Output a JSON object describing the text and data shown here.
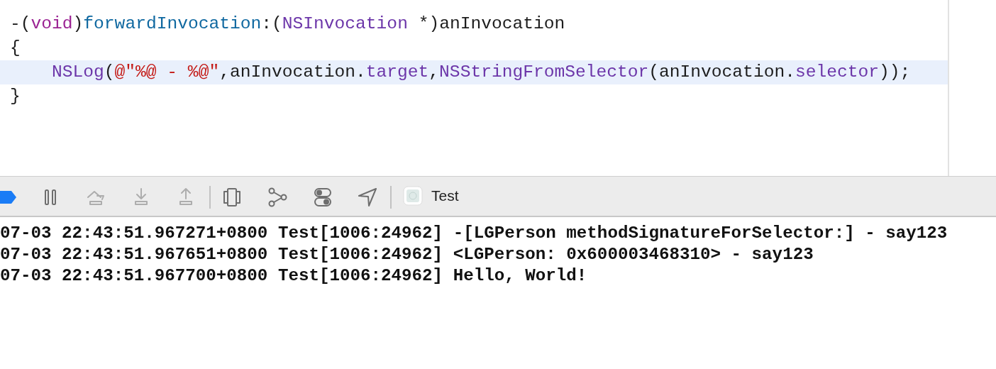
{
  "editor": {
    "lines": [
      {
        "highlighted": false,
        "tokens": [
          {
            "kind": "plain",
            "text": "-("
          },
          {
            "kind": "keyword",
            "text": "void"
          },
          {
            "kind": "plain",
            "text": ")"
          },
          {
            "kind": "declaration",
            "text": "forwardInvocation"
          },
          {
            "kind": "plain",
            "text": ":("
          },
          {
            "kind": "type",
            "text": "NSInvocation"
          },
          {
            "kind": "plain",
            "text": " *)anInvocation"
          }
        ]
      },
      {
        "highlighted": false,
        "tokens": [
          {
            "kind": "plain",
            "text": "{"
          }
        ]
      },
      {
        "highlighted": true,
        "indented": true,
        "tokens": [
          {
            "kind": "type",
            "text": "NSLog"
          },
          {
            "kind": "plain",
            "text": "("
          },
          {
            "kind": "string",
            "text": "@\"%@ - %@\""
          },
          {
            "kind": "plain",
            "text": ",anInvocation."
          },
          {
            "kind": "type",
            "text": "target"
          },
          {
            "kind": "plain",
            "text": ","
          },
          {
            "kind": "type",
            "text": "NSStringFromSelector"
          },
          {
            "kind": "plain",
            "text": "(anInvocation."
          },
          {
            "kind": "type",
            "text": "selector"
          },
          {
            "kind": "plain",
            "text": "));"
          }
        ]
      },
      {
        "highlighted": false,
        "tokens": [
          {
            "kind": "plain",
            "text": "}"
          }
        ]
      }
    ]
  },
  "debug_bar": {
    "buttons": [
      {
        "disabled": false
      },
      {
        "disabled": true
      },
      {
        "disabled": true
      },
      {
        "disabled": true
      },
      {
        "disabled": false
      },
      {
        "disabled": false
      },
      {
        "disabled": false
      },
      {
        "disabled": false
      }
    ],
    "target": "Test"
  },
  "console": {
    "lines": [
      "07-03 22:43:51.967271+0800 Test[1006:24962] -[LGPerson methodSignatureForSelector:] - say123",
      "07-03 22:43:51.967651+0800 Test[1006:24962] <LGPerson: 0x600003468310> - say123",
      "07-03 22:43:51.967700+0800 Test[1006:24962] Hello, World!"
    ]
  }
}
